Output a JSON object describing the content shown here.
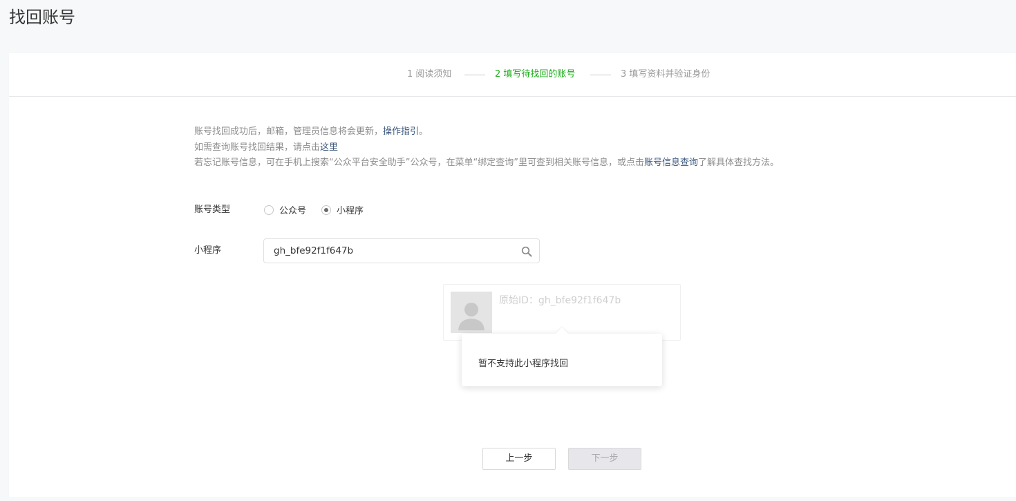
{
  "page": {
    "title": "找回账号"
  },
  "steps": [
    {
      "label": "1 阅读须知",
      "active": false
    },
    {
      "label": "2 填写待找回的账号",
      "active": true
    },
    {
      "label": "3 填写资料并验证身份",
      "active": false
    }
  ],
  "notes": {
    "line1_text": "账号找回成功后，邮箱，管理员信息将会更新，",
    "line1_link": "操作指引",
    "line1_tail": "。",
    "line2_text": "如需查询账号找回结果，请点击",
    "line2_link": "这里",
    "line3_text": "若忘记账号信息，可在手机上搜索“公众平台安全助手”公众号，在菜单“绑定查询”里可查到相关账号信息，或点击",
    "line3_link": "账号信息查询",
    "line3_tail": "了解具体查找方法。"
  },
  "form": {
    "account_type_label": "账号类型",
    "options": [
      {
        "label": "公众号",
        "checked": false
      },
      {
        "label": "小程序",
        "checked": true
      }
    ],
    "miniprogram_label": "小程序",
    "search_value": "gh_bfe92f1f647b",
    "search_icon": "search-icon"
  },
  "result": {
    "orig_id_text": "原始ID：gh_bfe92f1f647b",
    "avatar_icon": "user-placeholder-icon"
  },
  "tooltip": {
    "text": "暂不支持此小程序找回"
  },
  "buttons": {
    "prev": "上一步",
    "next": "下一步"
  },
  "colors": {
    "accent": "#1aad19",
    "link": "#3e5a7f",
    "muted": "#8d8d8d"
  }
}
